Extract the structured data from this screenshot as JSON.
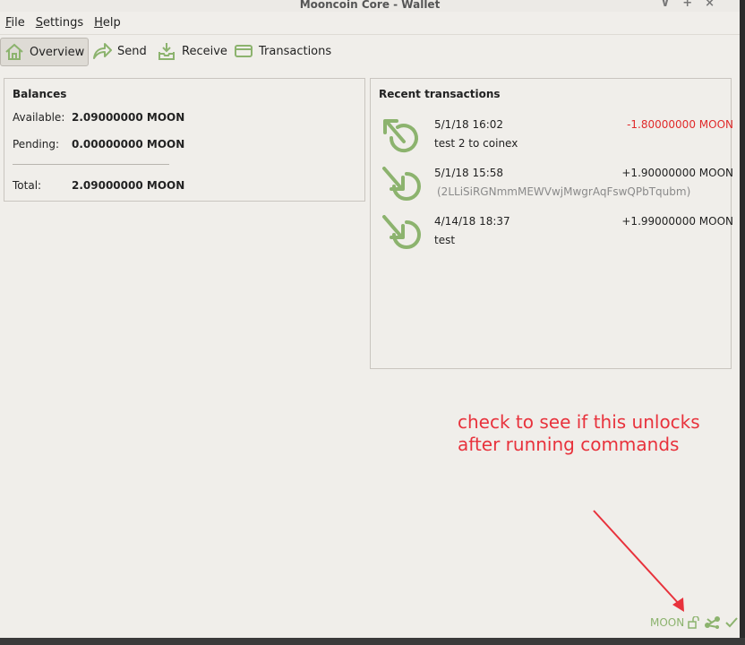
{
  "window": {
    "title": "Mooncoin Core - Wallet",
    "controls": [
      "∨",
      "+",
      "×"
    ]
  },
  "menu": [
    {
      "label": "File",
      "underline": "F",
      "rest": "ile"
    },
    {
      "label": "Settings",
      "underline": "S",
      "rest": "ettings"
    },
    {
      "label": "Help",
      "underline": "H",
      "rest": "elp"
    }
  ],
  "toolbar": {
    "overview": "Overview",
    "send": "Send",
    "receive": "Receive",
    "transactions": "Transactions"
  },
  "balances": {
    "title": "Balances",
    "available_label": "Available:",
    "available_value": "2.09000000 MOON",
    "pending_label": "Pending:",
    "pending_value": "0.00000000 MOON",
    "total_label": "Total:",
    "total_value": "2.09000000 MOON"
  },
  "recent": {
    "title": "Recent transactions",
    "items": [
      {
        "date": "5/1/18 16:02",
        "amount": "-1.80000000 MOON",
        "desc": "test 2 to coinex",
        "direction": "sent",
        "amount_color": "#e02a2a"
      },
      {
        "date": "5/1/18 15:58",
        "amount": "+1.90000000 MOON",
        "desc": "(2LLiSiRGNmmMEWVwjMwgrAqFswQPbTqubm)",
        "direction": "received",
        "amount_color": "#222222"
      },
      {
        "date": "4/14/18 18:37",
        "amount": "+1.99000000 MOON",
        "desc": "test",
        "direction": "received",
        "amount_color": "#222222"
      }
    ]
  },
  "annotation": {
    "text": "check to see if this unlocks\nafter running commands",
    "color": "#e8323c"
  },
  "status": {
    "unit": "MOON",
    "icons": [
      "lock-open-icon",
      "network-icon",
      "synced-check-icon"
    ]
  },
  "colors": {
    "accent_green": "#8cb36e",
    "negative_red": "#e02a2a"
  }
}
